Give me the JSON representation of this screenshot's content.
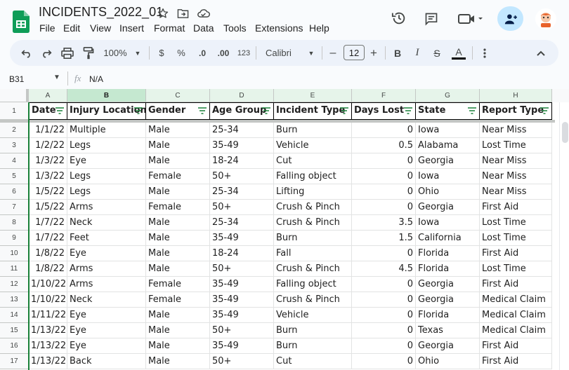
{
  "app": {
    "doc_title": "INCIDENTS_2022_01",
    "menu": [
      "File",
      "Edit",
      "View",
      "Insert",
      "Format",
      "Data",
      "Tools",
      "Extensions",
      "Help"
    ],
    "icons": [
      "star-icon",
      "move-to-folder-icon",
      "cloud-status-icon",
      "history-icon",
      "comments-icon",
      "meet-video-icon",
      "share-add-person-icon",
      "avatar"
    ]
  },
  "toolbar": {
    "zoom": "100%",
    "currency": "$",
    "percent": "%",
    "decrease_decimal": ".0",
    "increase_decimal": ".00",
    "number_format": "123",
    "font": "Calibri",
    "font_size": "12",
    "minus": "–",
    "plus": "+",
    "bold": "B",
    "italic": "I",
    "strike": "S",
    "text_color": "A"
  },
  "formula_bar": {
    "cell_ref": "B31",
    "fx": "fx",
    "value": "N/A"
  },
  "columns": [
    "A",
    "B",
    "C",
    "D",
    "E",
    "F",
    "G",
    "H"
  ],
  "headers": [
    "Date",
    "Injury Location",
    "Gender",
    "Age Group",
    "Incident Type",
    "Days Lost",
    "State",
    "Report Type"
  ],
  "header_row_number": "1",
  "rows": [
    {
      "n": "2",
      "cells": [
        "1/1/22",
        "Multiple",
        "Male",
        "25-34",
        "Burn",
        "0",
        "Iowa",
        "Near Miss"
      ]
    },
    {
      "n": "3",
      "cells": [
        "1/2/22",
        "Legs",
        "Male",
        "35-49",
        "Vehicle",
        "0.5",
        "Alabama",
        "Lost Time"
      ]
    },
    {
      "n": "4",
      "cells": [
        "1/3/22",
        "Eye",
        "Male",
        "18-24",
        "Cut",
        "0",
        "Georgia",
        "Near Miss"
      ]
    },
    {
      "n": "5",
      "cells": [
        "1/3/22",
        "Legs",
        "Female",
        "50+",
        "Falling object",
        "0",
        "Iowa",
        "Near Miss"
      ]
    },
    {
      "n": "6",
      "cells": [
        "1/5/22",
        "Legs",
        "Male",
        "25-34",
        "Lifting",
        "0",
        "Ohio",
        "Near Miss"
      ]
    },
    {
      "n": "7",
      "cells": [
        "1/5/22",
        "Arms",
        "Female",
        "50+",
        "Crush & Pinch",
        "0",
        "Georgia",
        "First Aid"
      ]
    },
    {
      "n": "8",
      "cells": [
        "1/7/22",
        "Neck",
        "Male",
        "25-34",
        "Crush & Pinch",
        "3.5",
        "Iowa",
        "Lost Time"
      ]
    },
    {
      "n": "9",
      "cells": [
        "1/7/22",
        "Feet",
        "Male",
        "35-49",
        "Burn",
        "1.5",
        "California",
        "Lost Time"
      ]
    },
    {
      "n": "10",
      "cells": [
        "1/8/22",
        "Eye",
        "Male",
        "18-24",
        "Fall",
        "0",
        "Florida",
        "First Aid"
      ]
    },
    {
      "n": "11",
      "cells": [
        "1/8/22",
        "Arms",
        "Male",
        "50+",
        "Crush & Pinch",
        "4.5",
        "Florida",
        "Lost Time"
      ]
    },
    {
      "n": "12",
      "cells": [
        "1/10/22",
        "Arms",
        "Female",
        "35-49",
        "Falling object",
        "0",
        "Georgia",
        "First Aid"
      ]
    },
    {
      "n": "13",
      "cells": [
        "1/10/22",
        "Neck",
        "Female",
        "35-49",
        "Crush & Pinch",
        "0",
        "Georgia",
        "Medical Claim"
      ]
    },
    {
      "n": "14",
      "cells": [
        "1/11/22",
        "Eye",
        "Male",
        "35-49",
        "Vehicle",
        "0",
        "Florida",
        "Medical Claim"
      ]
    },
    {
      "n": "15",
      "cells": [
        "1/13/22",
        "Eye",
        "Male",
        "50+",
        "Burn",
        "0",
        "Texas",
        "Medical Claim"
      ]
    },
    {
      "n": "16",
      "cells": [
        "1/13/22",
        "Eye",
        "Male",
        "35-49",
        "Burn",
        "0",
        "Georgia",
        "First Aid"
      ]
    },
    {
      "n": "17",
      "cells": [
        "1/13/22",
        "Back",
        "Male",
        "50+",
        "Cut",
        "0",
        "Ohio",
        "First Aid"
      ]
    }
  ],
  "colors": {
    "accent_green": "#0f9d58",
    "selected_column": "#c5e8d0",
    "share_button": "#c2e7ff",
    "toolbar_bg": "#edf2fa"
  }
}
